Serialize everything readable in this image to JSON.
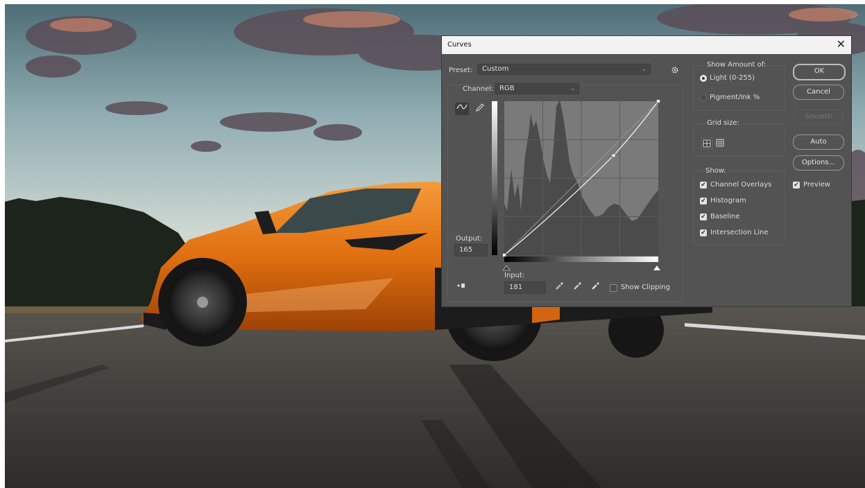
{
  "dialog": {
    "title": "Curves",
    "close_glyph": "✕",
    "preset_label": "Preset:",
    "preset_value": "Custom",
    "channel_label": "Channel:",
    "channel_value": "RGB",
    "output_label": "Output:",
    "output_value": "165",
    "input_label": "Input:",
    "input_value": "181",
    "show_clipping_label": "Show Clipping",
    "show_amount_label": "Show Amount of:",
    "light_label": "Light  (0-255)",
    "pigment_label": "Pigment/Ink %",
    "grid_size_label": "Grid size:",
    "show_label": "Show:",
    "channel_overlays_label": "Channel Overlays",
    "histogram_label": "Histogram",
    "baseline_label": "Baseline",
    "intersection_line_label": "Intersection Line",
    "buttons": {
      "ok": "OK",
      "cancel": "Cancel",
      "smooth": "Smooth",
      "auto": "Auto",
      "options": "Options..."
    },
    "preview_label": "Preview",
    "state": {
      "light_selected": true,
      "pigment_selected": false,
      "channel_overlays": true,
      "histogram": true,
      "baseline": true,
      "intersection_line": true,
      "preview": true,
      "show_clipping": false
    }
  },
  "curve": {
    "control_points": [
      [
        0,
        0
      ],
      [
        181,
        165
      ],
      [
        255,
        255
      ]
    ]
  },
  "colors": {
    "dialog_bg": "#535353",
    "graph_bg": "#7a7a7a",
    "histogram_fill": "#4b4b4b",
    "car_orange": "#e8730f"
  },
  "icons": {
    "gear": "gear-icon",
    "curve_tool": "curve-point-tool-icon",
    "pencil_tool": "pencil-icon",
    "target_adjust": "target-adjust-icon",
    "eyedropper_black": "black-eyedropper-icon",
    "eyedropper_gray": "gray-eyedropper-icon",
    "eyedropper_white": "white-eyedropper-icon",
    "grid_small": "simple-grid-icon",
    "grid_large": "detailed-grid-icon"
  }
}
